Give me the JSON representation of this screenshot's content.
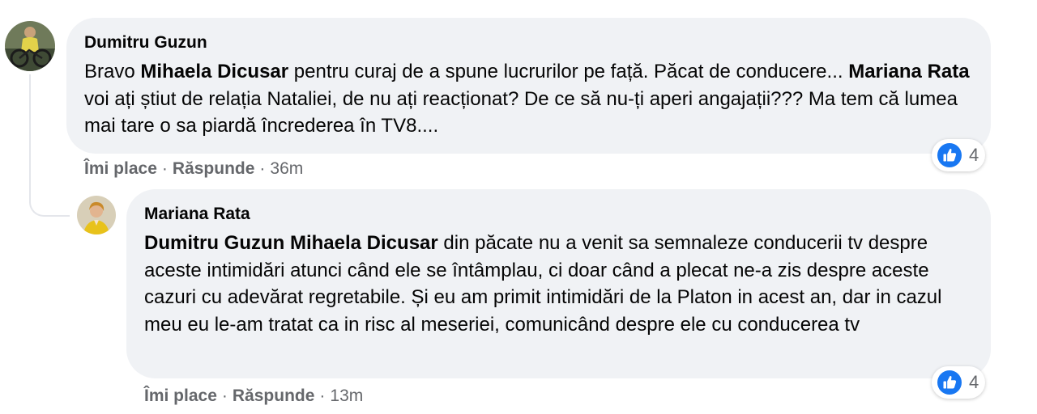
{
  "comments": [
    {
      "author": "Dumitru Guzun",
      "text": [
        {
          "t": "Bravo ",
          "b": false
        },
        {
          "t": "Mihaela Dicusar",
          "b": true
        },
        {
          "t": " pentru curaj de a spune lucrurilor pe față. Păcat de conducere... ",
          "b": false
        },
        {
          "t": "Mariana Rata",
          "b": true
        },
        {
          "t": " voi ați știut de relația Nataliei, de nu ați reacționat? De ce să nu-ți aperi angajații??? Ma tem că lumea mai tare o sa piardă încrederea în TV8....",
          "b": false
        }
      ],
      "actions": {
        "like": "Îmi place",
        "reply": "Răspunde",
        "separator": "·",
        "time": "36m"
      },
      "reactions": {
        "icon": "thumbs-up-icon",
        "count": "4"
      }
    },
    {
      "author": "Mariana Rata",
      "text": [
        {
          "t": "Dumitru Guzun",
          "b": true
        },
        {
          "t": " ",
          "b": false
        },
        {
          "t": "Mihaela Dicusar",
          "b": true
        },
        {
          "t": " din păcate nu a venit sa semnaleze conducerii tv despre aceste intimidări atunci când ele se întâmplau, ci doar când a plecat ne-a zis despre aceste cazuri cu adevărat regretabile. Și eu am primit intimidări de la Platon in acest an, dar in cazul meu eu le-am tratat ca in risc al meseriei, comunicând despre ele cu conducerea tv",
          "b": false
        }
      ],
      "actions": {
        "like": "Îmi place",
        "reply": "Răspunde",
        "separator": "·",
        "time": "13m"
      },
      "reactions": {
        "icon": "thumbs-up-icon",
        "count": "4"
      }
    }
  ],
  "colors": {
    "bubble": "#f0f2f5",
    "muted_text": "#65676b",
    "like_blue": "#1877f2"
  }
}
